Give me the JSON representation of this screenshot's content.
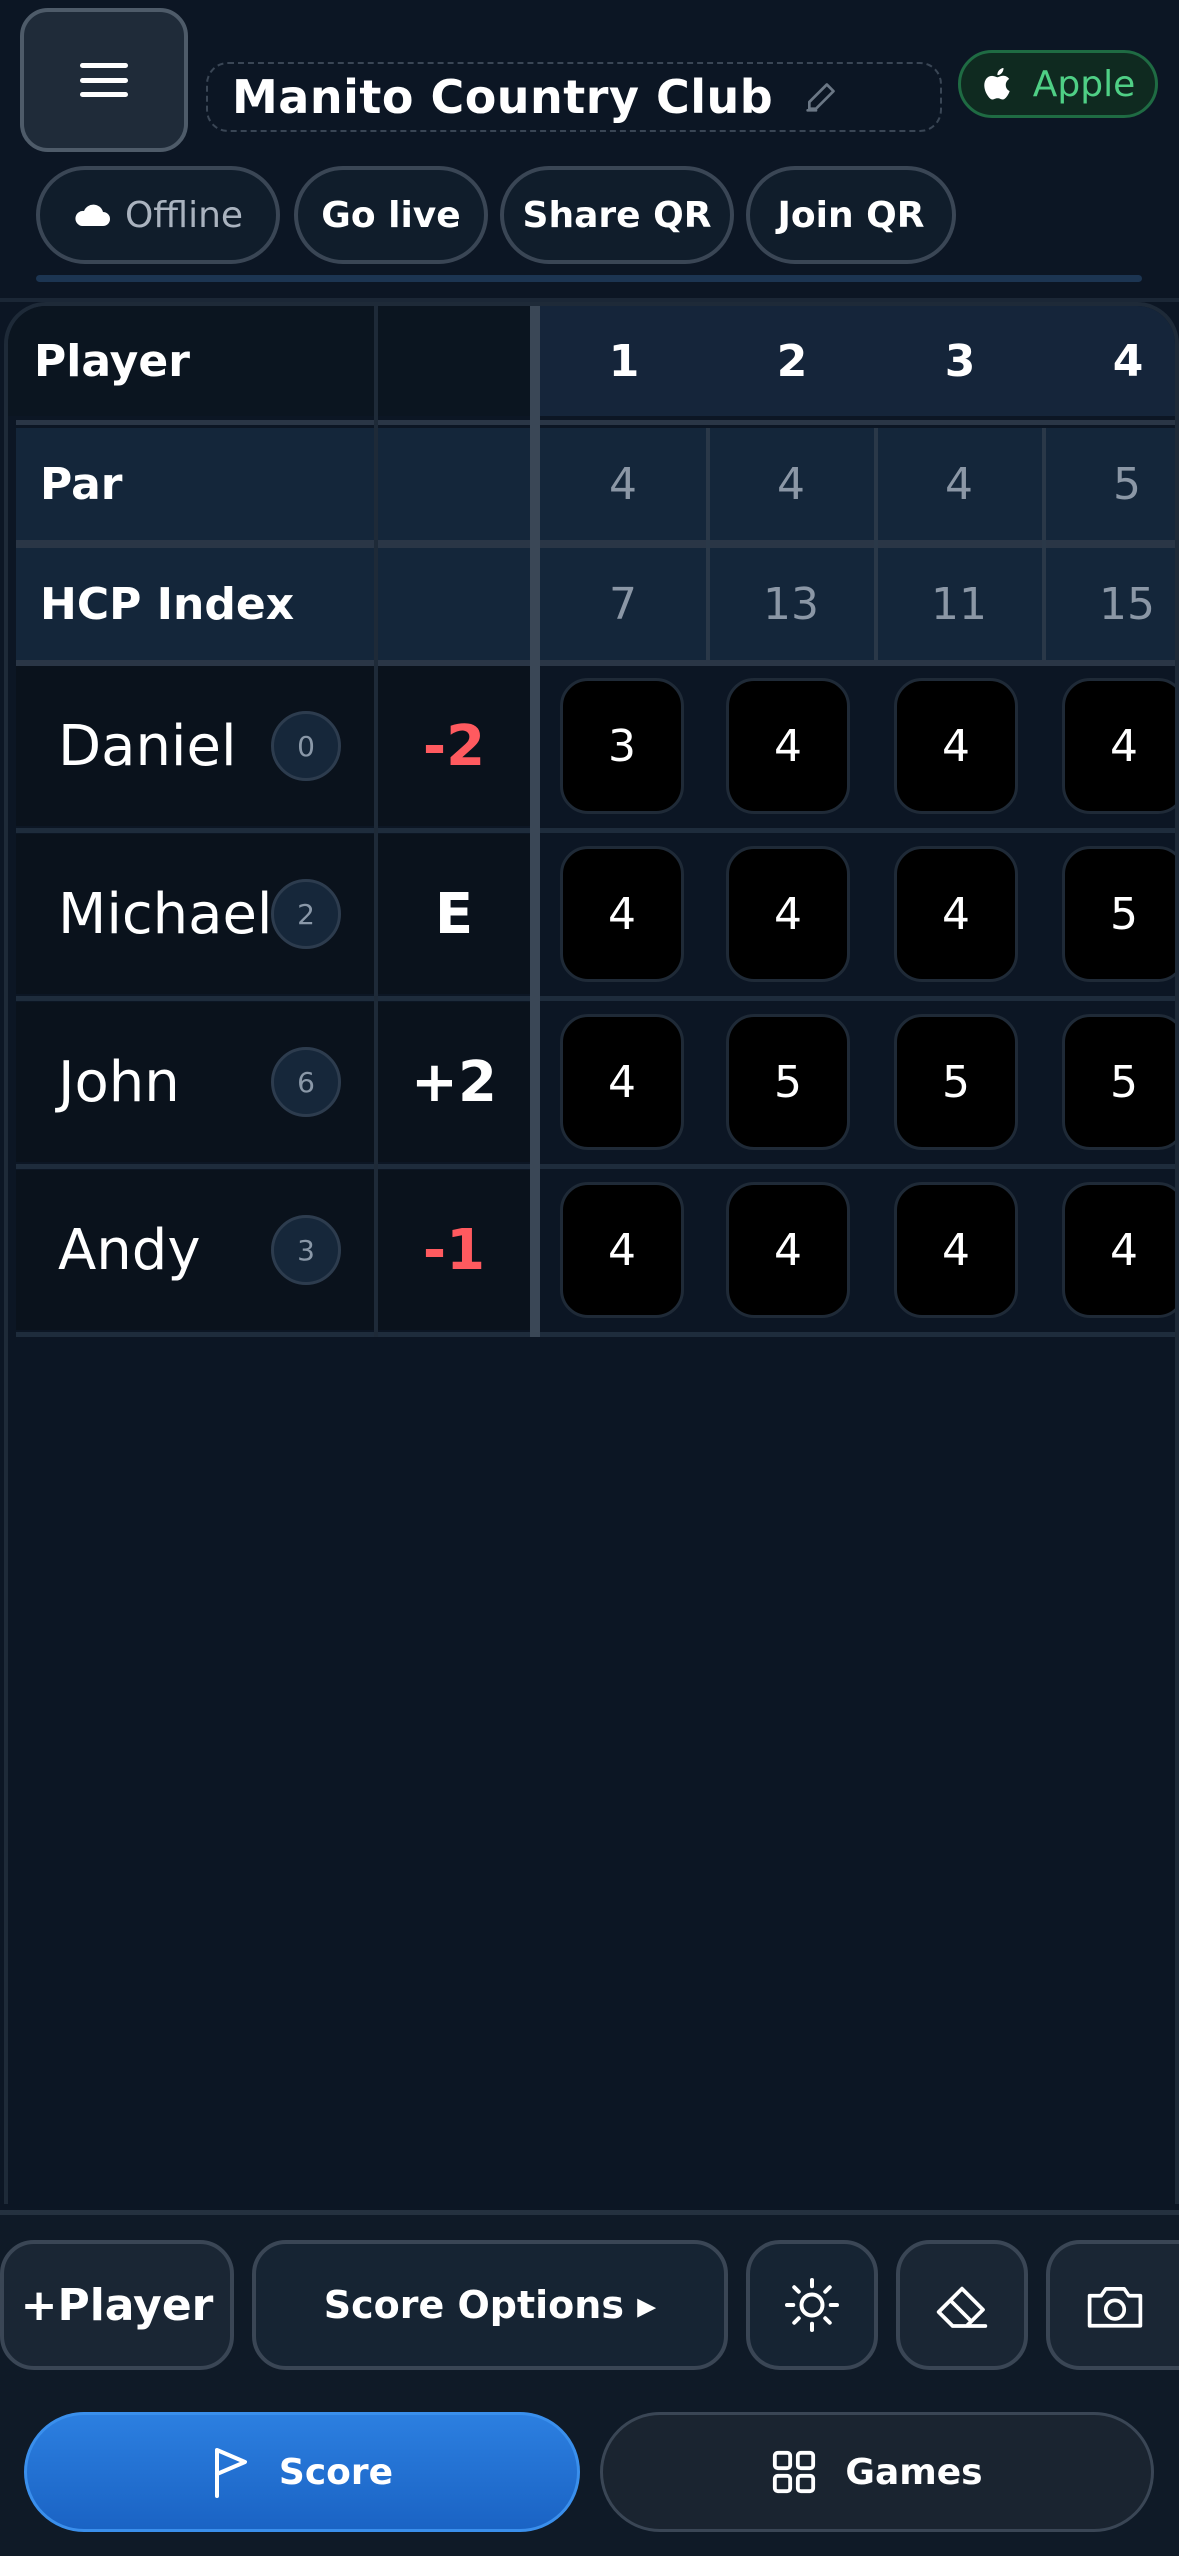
{
  "header": {
    "course_name": "Manito Country Club",
    "platform_badge": "Apple",
    "pills": [
      "Offline",
      "Go live",
      "Share QR",
      "Join QR"
    ]
  },
  "table": {
    "player_header": "Player",
    "holes": [
      "1",
      "2",
      "3",
      "4"
    ],
    "par_label": "Par",
    "par": [
      "4",
      "4",
      "4",
      "5"
    ],
    "hcp_label": "HCP Index",
    "hcp_index": [
      "7",
      "13",
      "11",
      "15"
    ],
    "players": [
      {
        "name": "Daniel",
        "hcp": "0",
        "total": "-2",
        "scores": [
          "3",
          "4",
          "4",
          "4"
        ]
      },
      {
        "name": "Michael",
        "hcp": "2",
        "total": "E",
        "scores": [
          "4",
          "4",
          "4",
          "5"
        ]
      },
      {
        "name": "John",
        "hcp": "6",
        "total": "+2",
        "scores": [
          "4",
          "5",
          "5",
          "5"
        ]
      },
      {
        "name": "Andy",
        "hcp": "3",
        "total": "-1",
        "scores": [
          "4",
          "4",
          "4",
          "4"
        ]
      }
    ]
  },
  "controls": {
    "add_player": "+Player",
    "score_options": "Score Options ▸"
  },
  "nav": {
    "score": "Score",
    "games": "Games"
  },
  "colors": {
    "under_par": "#ff5a5f",
    "even_or_over": "#ffffff",
    "accent_blue": "#1f6fd6",
    "apple_green": "#4fcf85"
  }
}
